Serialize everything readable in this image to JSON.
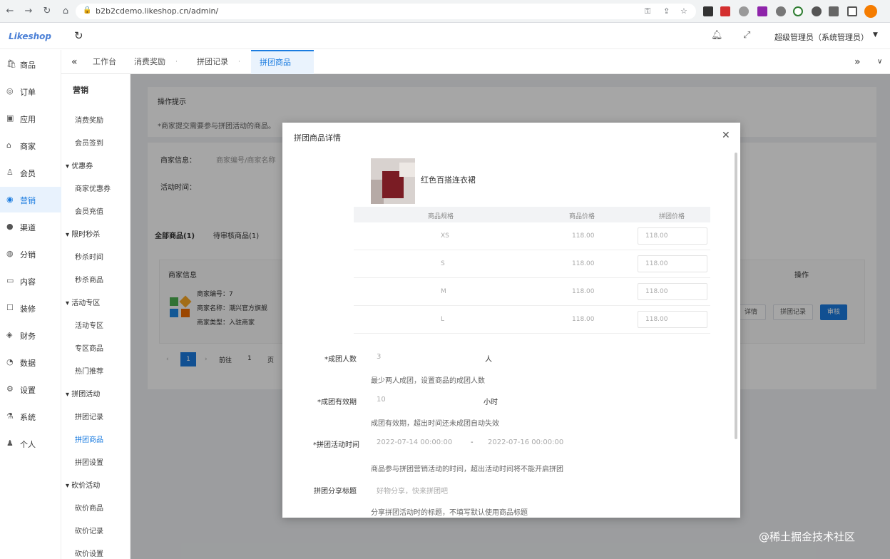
{
  "browser": {
    "url": "b2b2cdemo.likeshop.cn/admin/"
  },
  "app": {
    "logo": "Likeshop",
    "user": "超级管理员（系统管理员）"
  },
  "tabs": [
    {
      "label": "工作台"
    },
    {
      "label": "消费奖励"
    },
    {
      "label": "拼团记录"
    },
    {
      "label": "拼团商品"
    }
  ],
  "nav": [
    {
      "label": "商品",
      "icon": "bag-icon"
    },
    {
      "label": "订单",
      "icon": "order-icon"
    },
    {
      "label": "应用",
      "icon": "app-icon"
    },
    {
      "label": "商家",
      "icon": "shop-icon"
    },
    {
      "label": "会员",
      "icon": "user-icon"
    },
    {
      "label": "营销",
      "icon": "marketing-icon"
    },
    {
      "label": "渠道",
      "icon": "channel-icon"
    },
    {
      "label": "分销",
      "icon": "distribution-icon"
    },
    {
      "label": "内容",
      "icon": "content-icon"
    },
    {
      "label": "装修",
      "icon": "decorate-icon"
    },
    {
      "label": "财务",
      "icon": "finance-icon"
    },
    {
      "label": "数据",
      "icon": "data-icon"
    },
    {
      "label": "设置",
      "icon": "settings-icon"
    },
    {
      "label": "系统",
      "icon": "system-icon"
    },
    {
      "label": "个人",
      "icon": "person-icon"
    }
  ],
  "subnav": {
    "title": "营销",
    "items": [
      {
        "label": "消费奖励",
        "type": "item"
      },
      {
        "label": "会员签到",
        "type": "item"
      },
      {
        "label": "优惠券",
        "type": "group"
      },
      {
        "label": "商家优惠券",
        "type": "item"
      },
      {
        "label": "会员充值",
        "type": "item"
      },
      {
        "label": "限时秒杀",
        "type": "group"
      },
      {
        "label": "秒杀时间",
        "type": "item"
      },
      {
        "label": "秒杀商品",
        "type": "item"
      },
      {
        "label": "活动专区",
        "type": "group"
      },
      {
        "label": "活动专区",
        "type": "item"
      },
      {
        "label": "专区商品",
        "type": "item"
      },
      {
        "label": "热门推荐",
        "type": "item"
      },
      {
        "label": "拼团活动",
        "type": "group"
      },
      {
        "label": "拼团记录",
        "type": "item"
      },
      {
        "label": "拼团商品",
        "type": "item"
      },
      {
        "label": "拼团设置",
        "type": "item"
      },
      {
        "label": "砍价活动",
        "type": "group"
      },
      {
        "label": "砍价商品",
        "type": "item"
      },
      {
        "label": "砍价记录",
        "type": "item"
      },
      {
        "label": "砍价设置",
        "type": "item"
      }
    ]
  },
  "background": {
    "tips_title": "操作提示",
    "tips_text": "*商家提交需要参与拼团活动的商品。",
    "label_shop": "商家信息：",
    "placeholder_shop": "商家编号/商家名称",
    "label_time": "活动时间：",
    "tab_all": "全部商品(1)",
    "tab_pending": "待审核商品(1)",
    "col_shop": "商家信息",
    "col_action": "操作",
    "shop_no_label": "商家编号：",
    "shop_no": "7",
    "shop_name_label": "商家名称：",
    "shop_name": "潮兴官方旗舰",
    "shop_type_label": "商家类型：",
    "shop_type": "入驻商家",
    "btn_detail": "详情",
    "btn_record": "拼团记录",
    "btn_audit": "审核",
    "page_current": "1",
    "page_goto": "前往",
    "page_num": "1",
    "page_unit": "页"
  },
  "modal": {
    "title": "拼团商品详情",
    "product_name": "红色百搭连衣裙",
    "sku_headers": [
      "商品规格",
      "商品价格",
      "拼团价格"
    ],
    "sku_rows": [
      {
        "spec": "XS",
        "price": "118.00",
        "group": "118.00"
      },
      {
        "spec": "S",
        "price": "118.00",
        "group": "118.00"
      },
      {
        "spec": "M",
        "price": "118.00",
        "group": "118.00"
      },
      {
        "spec": "L",
        "price": "118.00",
        "group": "118.00"
      }
    ],
    "people_label": "*成团人数",
    "people_value": "3",
    "people_unit": "人",
    "people_hint": "最少两人成团，设置商品的成团人数",
    "valid_label": "*成团有效期",
    "valid_value": "10",
    "valid_unit": "小时",
    "valid_hint": "成团有效期，超出时间还未成团自动失效",
    "time_label": "*拼团活动时间",
    "time_start": "2022-07-14 00:00:00",
    "time_sep": "-",
    "time_end": "2022-07-16 00:00:00",
    "time_hint": "商品参与拼团营销活动的时间，超出活动时间将不能开启拼团",
    "share_label": "拼团分享标题",
    "share_placeholder": "好物分享，快来拼团吧",
    "share_hint": "分享拼团活动时的标题，不填写默认使用商品标题"
  },
  "watermark": "@稀土掘金技术社区",
  "colors": {
    "accent": "#1b7ce0"
  }
}
